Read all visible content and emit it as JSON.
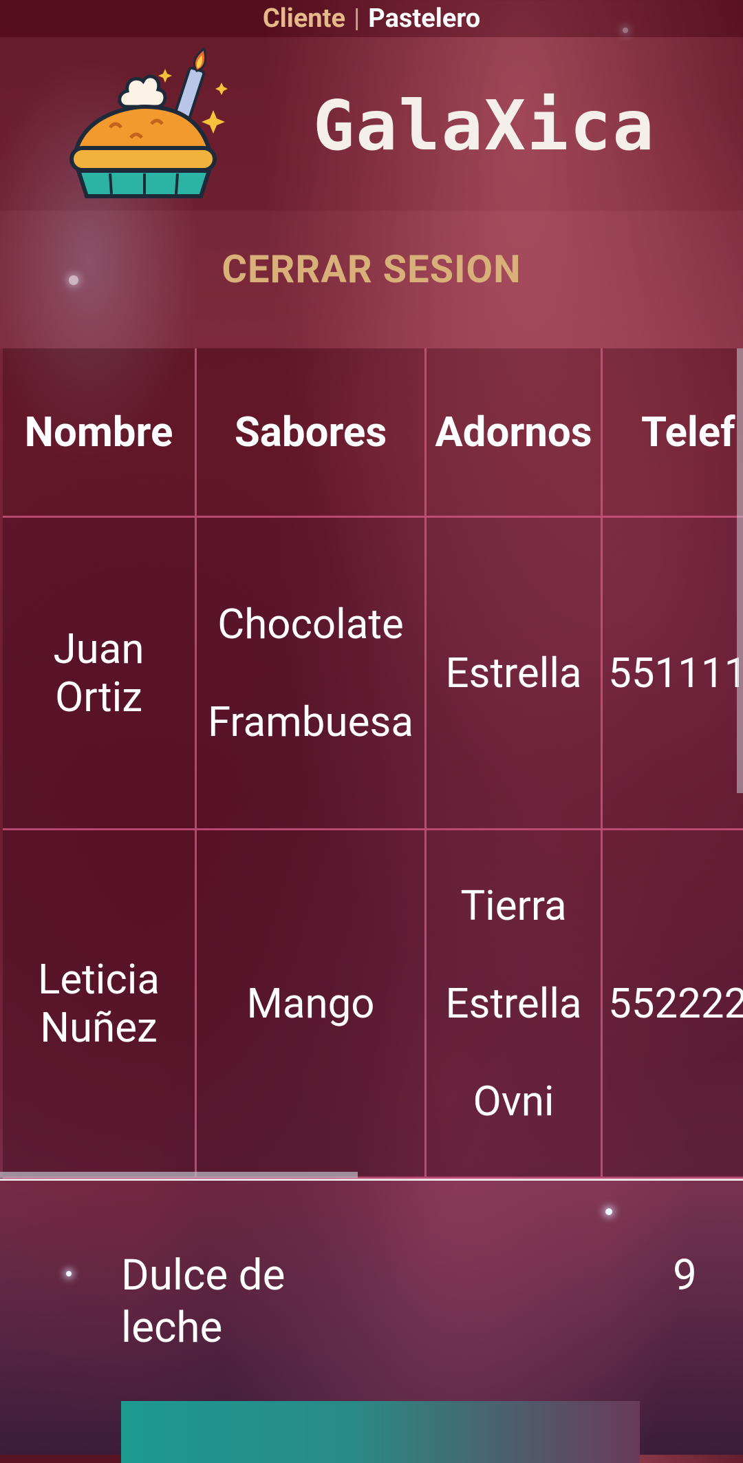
{
  "toggle": {
    "cliente_label": "Cliente",
    "separator": "|",
    "pastelero_label": "Pastelero"
  },
  "header": {
    "brand": "GalaXica",
    "logo_icon": "pie-with-rocket-icon"
  },
  "logout_label": "CERRAR SESION",
  "table": {
    "columns": [
      "Nombre",
      "Sabores",
      "Adornos",
      "Telef"
    ],
    "rows": [
      {
        "nombre": [
          "Juan",
          "Ortiz"
        ],
        "sabores": [
          "Chocolate",
          "Frambuesa"
        ],
        "adornos": [
          "Estrella"
        ],
        "telefono": "551111"
      },
      {
        "nombre": [
          "Leticia",
          "Nuñez"
        ],
        "sabores": [
          "Mango"
        ],
        "adornos": [
          "Tierra",
          "Estrella",
          "Ovni"
        ],
        "telefono": "552222"
      }
    ]
  },
  "item": {
    "name": "Dulce de leche",
    "quantity": "9"
  },
  "colors": {
    "accent_gold": "#d9b07a",
    "toggle_active": "#e7b98a",
    "grid_line": "#d75a87",
    "button_teal": "#1c9a90"
  }
}
